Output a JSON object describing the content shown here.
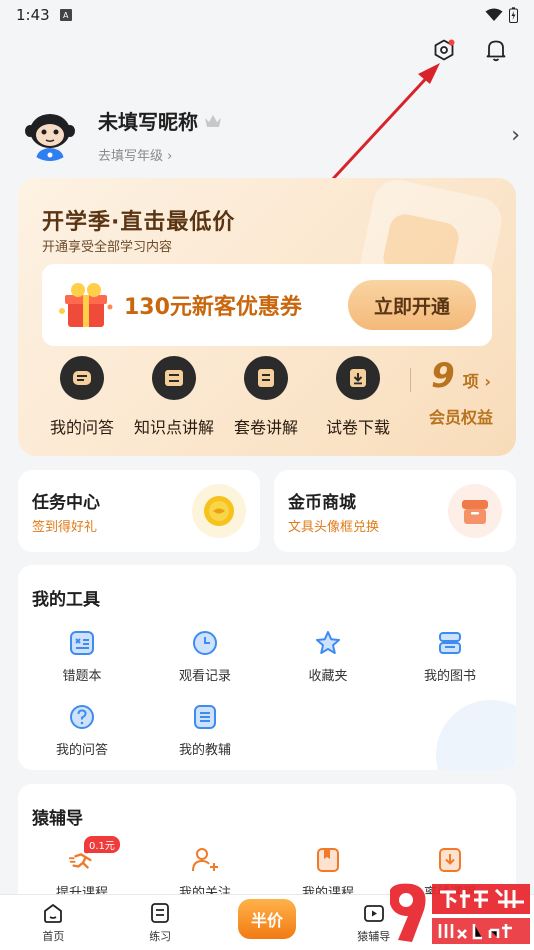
{
  "status_bar": {
    "time": "1:43",
    "sim_label": "A"
  },
  "profile": {
    "nickname": "未填写昵称",
    "grade_link": "去填写年级 ›"
  },
  "vip": {
    "title": "开学季·直击最低价",
    "subtitle": "开通享受全部学习内容",
    "coupon_text": "130元新客优惠券",
    "open_button": "立即开通",
    "perks": [
      {
        "label": "我的问答",
        "icon": "qa-icon"
      },
      {
        "label": "知识点讲解",
        "icon": "knowledge-icon"
      },
      {
        "label": "套卷讲解",
        "icon": "paper-set-icon"
      },
      {
        "label": "试卷下载",
        "icon": "download-icon"
      }
    ],
    "benefit_count": "9",
    "benefit_unit": "项 ›",
    "benefit_label": "会员权益"
  },
  "task_center": {
    "title": "任务中心",
    "subtitle": "签到得好礼"
  },
  "coin_mall": {
    "title": "金币商城",
    "subtitle": "文具头像框兑换"
  },
  "tools": {
    "title": "我的工具",
    "items": [
      {
        "label": "错题本",
        "icon": "mistake-book-icon"
      },
      {
        "label": "观看记录",
        "icon": "clock-icon"
      },
      {
        "label": "收藏夹",
        "icon": "star-icon"
      },
      {
        "label": "我的图书",
        "icon": "books-icon"
      },
      {
        "label": "我的问答",
        "icon": "question-icon"
      },
      {
        "label": "我的教辅",
        "icon": "tutor-book-icon"
      }
    ]
  },
  "tutoring": {
    "title": "猿辅导",
    "badge": "0.1元",
    "items": [
      {
        "label": "提升课程",
        "icon": "runner-icon"
      },
      {
        "label": "我的关注",
        "icon": "follow-icon"
      },
      {
        "label": "我的课程",
        "icon": "course-icon"
      },
      {
        "label": "离线课程",
        "icon": "offline-download-icon"
      }
    ]
  },
  "bottom_nav": {
    "home": "首页",
    "practice": "练习",
    "half_price": "半价",
    "tutoring": "猿辅导"
  },
  "colors": {
    "accent_orange": "#e07b19",
    "tool_blue": "#3f8cf0",
    "vip_brown": "#5a3514"
  }
}
